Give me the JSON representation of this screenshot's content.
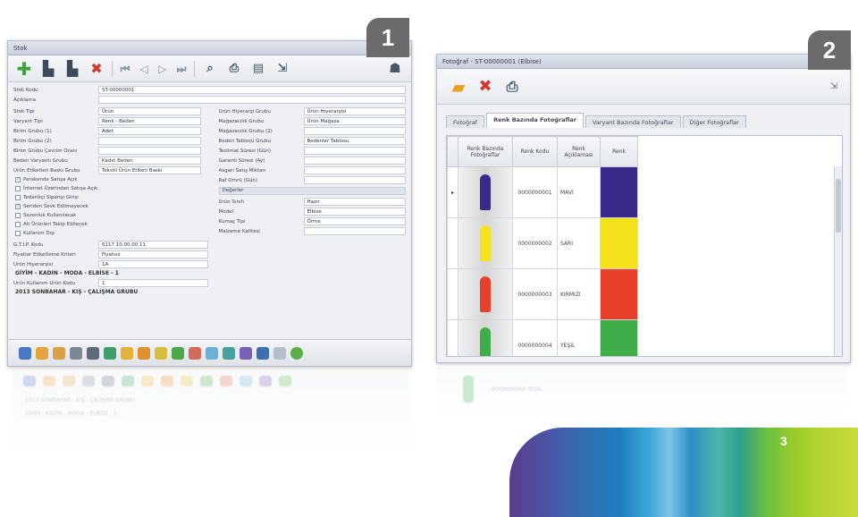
{
  "badges": {
    "one": "1",
    "two": "2",
    "three": "3"
  },
  "window1": {
    "title": "Stok",
    "header_fields": [
      {
        "label": "Stok Kodu",
        "value": "ST-00000001"
      },
      {
        "label": "Açıklama",
        "value": ""
      }
    ],
    "left_fields": [
      {
        "label": "Stok Tipi",
        "value": "Ürün"
      },
      {
        "label": "Varyant Tipi",
        "value": "Renk - Beden"
      },
      {
        "label": "Birim Grubu (1)",
        "value": "Adet"
      },
      {
        "label": "Birim Grubu (2)",
        "value": ""
      },
      {
        "label": "Birim Grubu Çevrim Oranı",
        "value": ""
      },
      {
        "label": "Beden Varyantı Grubu",
        "value": "Kadın Beden"
      },
      {
        "label": "Ürün Etiketleri Baskı Grubu",
        "value": "Tekstil Ürün Etiketi Baskı"
      }
    ],
    "right_fields": [
      {
        "label": "Ürün Hiyerarşi Grubu",
        "value": "Ürün Hiyerarşisi"
      },
      {
        "label": "Mağazacılık Grubu",
        "value": "Ürün Mağaza"
      },
      {
        "label": "Mağazacılık Grubu (2)",
        "value": ""
      },
      {
        "label": "Beden Tablosu Grubu",
        "value": "Bedenler Tablosu"
      },
      {
        "label": "Teslimat Süresi (Gün)",
        "value": ""
      },
      {
        "label": "Garanti Süresi (Ay)",
        "value": ""
      },
      {
        "label": "Asgari Satış Miktarı",
        "value": ""
      },
      {
        "label": "Raf Ömrü (Gün)",
        "value": ""
      }
    ],
    "checks": [
      {
        "label": "Perakende Satışa Açık",
        "checked": true
      },
      {
        "label": "İnternet Üzerinden Satışa Açık",
        "checked": false
      },
      {
        "label": "Tedarikçi Siparişi Girişi",
        "checked": false
      },
      {
        "label": "Seriden Sevk Edilmeyecek",
        "checked": true
      },
      {
        "label": "Sezonluk Kullanılacak",
        "checked": false
      },
      {
        "label": "Alt Ürünleri Takip Edilecek",
        "checked": false
      },
      {
        "label": "Kullanım Dışı",
        "checked": false
      }
    ],
    "section_label": "Değerler",
    "value_fields": [
      {
        "label": "Ürün Sınıfı",
        "value": "Hazır"
      },
      {
        "label": "Model",
        "value": "Elbise"
      },
      {
        "label": "Kumaş Tipi",
        "value": "Örme"
      },
      {
        "label": "Malzeme Kalitesi",
        "value": ""
      }
    ],
    "lower_fields": [
      {
        "label": "G.T.İ.P. Kodu",
        "value": "6117.10.00.00.11"
      },
      {
        "label": "Fiyatlar Etiketleme Kriteri",
        "value": "Fiyatsız"
      },
      {
        "label": "Ürün Hiyerarşisi",
        "value": "1A"
      },
      {
        "label": "Ürün Kullanım Ürün Kodu",
        "value": "1"
      }
    ],
    "bold_lines": [
      "GİYİM - KADIN - MODA - ELBİSE - 1",
      "2013 SONBAHAR - KIŞ - ÇALIŞMA GRUBU"
    ]
  },
  "window2": {
    "title": "Fotoğraf - ST-00000001 (Elbise)",
    "tabs": [
      "Fotoğraf",
      "Renk Bazında Fotoğraflar",
      "Varyant Bazında Fotoğraflar",
      "Diğer Fotoğraflar"
    ],
    "columns": [
      "Renk Bazında Fotoğraflar",
      "Renk Kodu",
      "Renk Açıklaması",
      "Renk"
    ],
    "rows": [
      {
        "code": "0000000001",
        "desc": "MAVİ",
        "color": "#3a2a8c"
      },
      {
        "code": "0000000002",
        "desc": "SARI",
        "color": "#f4e21a"
      },
      {
        "code": "0000000003",
        "desc": "KIRMIZI",
        "color": "#e8402a"
      },
      {
        "code": "0000000004",
        "desc": "YEŞİL",
        "color": "#3fae4a"
      }
    ],
    "selected_marker": "▸"
  },
  "reflection_lines": [
    "2013 SONBAHAR - KIŞ - ÇALIŞMA GRUBU",
    "GİYİM - KADIN - MODA - ELBİSE - 1"
  ],
  "reflection_code": "0000000004  YEŞİL"
}
